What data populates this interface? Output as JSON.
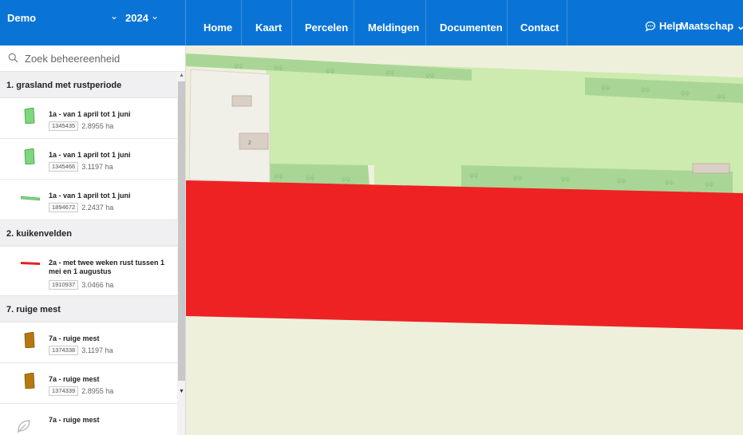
{
  "topbar": {
    "demo": "Demo",
    "year": "2024",
    "nav": [
      "Home",
      "Kaart",
      "Percelen",
      "Meldingen",
      "Documenten",
      "Contact"
    ],
    "help": "Help",
    "maatschap": "Maatschap"
  },
  "search": {
    "placeholder": "Zoek beheereenheid"
  },
  "groups": [
    {
      "header": "1. grasland met rustperiode",
      "items": [
        {
          "title": "1a - van 1 april tot 1 juni",
          "id": "1345435",
          "area": "2.8955 ha"
        },
        {
          "title": "1a - van 1 april tot 1 juni",
          "id": "1345466",
          "area": "3.1197 ha"
        },
        {
          "title": "1a - van 1 april tot 1 juni",
          "id": "1894672",
          "area": "2.2437 ha"
        }
      ]
    },
    {
      "header": "2. kuikenvelden",
      "items": [
        {
          "title": "2a - met twee weken rust tussen 1 mei en 1 augustus",
          "id": "1910937",
          "area": "3.0466 ha"
        }
      ]
    },
    {
      "header": "7. ruige mest",
      "items": [
        {
          "title": "7a - ruige mest",
          "id": "1374338",
          "area": "3.1197 ha"
        },
        {
          "title": "7a - ruige mest",
          "id": "1374339",
          "area": "2.8955 ha"
        },
        {
          "title": "7a - ruige mest",
          "id": "",
          "area": ""
        }
      ]
    }
  ],
  "map": {
    "building_label": "2"
  },
  "colors": {
    "brand": "#0a74d6",
    "grassland": "#7ed67e",
    "kuiken": "#e32222",
    "ruige_mest": "#b8780f",
    "map_field_red": "#ee2222",
    "map_light_green": "#cdeaaf",
    "map_hedge": "#a9d696"
  },
  "icons": [
    "search-icon",
    "help-chat-icon",
    "caret-down-icon",
    "leaf-icon"
  ]
}
